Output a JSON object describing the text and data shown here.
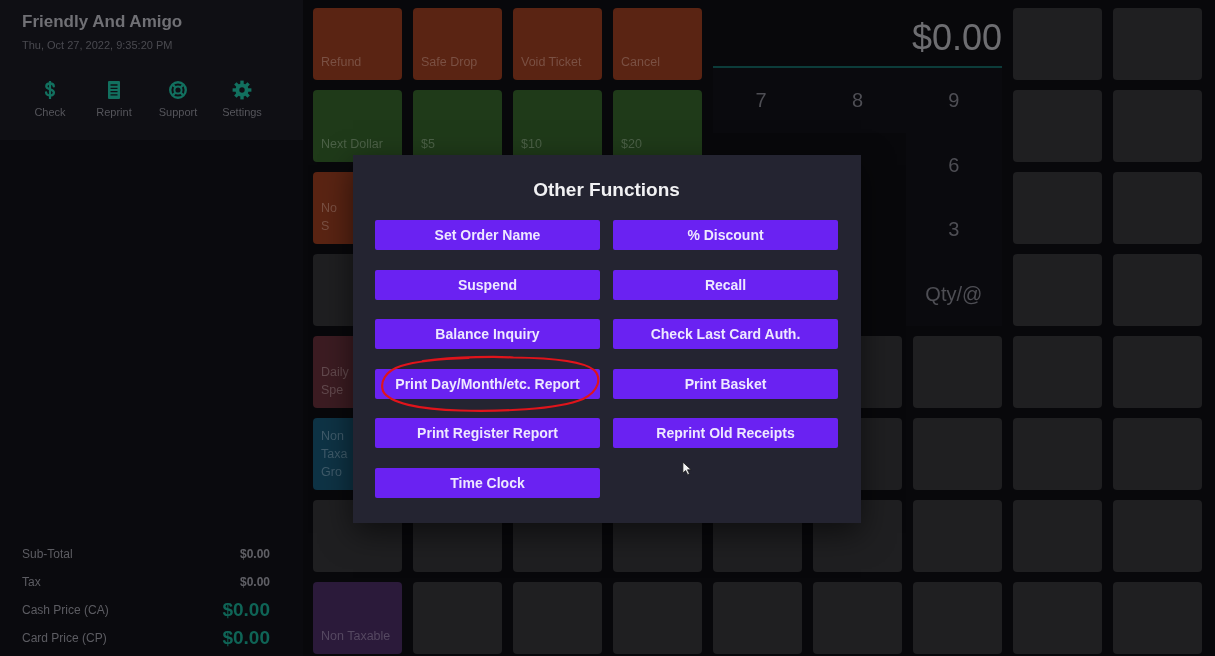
{
  "store": {
    "name": "Friendly And Amigo",
    "datetime": "Thu, Oct 27, 2022, 9:35:20 PM"
  },
  "header_actions": [
    {
      "label": "Check"
    },
    {
      "label": "Reprint"
    },
    {
      "label": "Support"
    },
    {
      "label": "Settings"
    }
  ],
  "totals": [
    {
      "label": "Sub-Total",
      "amount": "$0.00",
      "kind": "plain"
    },
    {
      "label": "Tax",
      "amount": "$0.00",
      "kind": "plain"
    },
    {
      "label": "Cash Price (CA)",
      "amount": "$0.00",
      "kind": "price"
    },
    {
      "label": "Card Price (CP)",
      "amount": "$0.00",
      "kind": "price"
    }
  ],
  "display": {
    "amount": "$0.00"
  },
  "keypad": [
    [
      "7",
      "8",
      "9"
    ],
    [
      "6"
    ],
    [
      "3"
    ],
    [
      "Qty/@"
    ]
  ],
  "tile_rows": [
    [
      {
        "label": "Refund",
        "color": "#5a2413"
      },
      {
        "label": "Safe Drop",
        "color": "#5a2413",
        "cut_off": false
      },
      {
        "label": "Void Ticket",
        "color": "#5a2413",
        "cut_off": false
      },
      {
        "label": "Cancel",
        "color": "#5a2413"
      },
      {
        "color": "#1f1f21"
      },
      {
        "color": "#1f1f21"
      }
    ],
    [
      {
        "label": "Next Dollar",
        "color": "#1f3a19",
        "cut_off": false
      },
      {
        "label": "$5",
        "color": "#1f3a19"
      },
      {
        "label": "$10",
        "color": "#1f3a19"
      },
      {
        "label": "$20",
        "color": "#1f3a19"
      },
      {
        "color": "#1f1f21"
      },
      {
        "color": "#1f1f21"
      }
    ],
    [
      {
        "label": "No S",
        "color": "#5a2413",
        "cut_off": true
      },
      null,
      null,
      null,
      {
        "color": "#1f1f21"
      },
      {
        "color": "#1f1f21"
      }
    ],
    [
      {
        "color": "#1f1f21"
      },
      null,
      null,
      null,
      {
        "color": "#1f1f21"
      },
      {
        "color": "#1f1f21"
      }
    ],
    [
      {
        "label": "Daily Spe",
        "color": "#3c1c22",
        "cut_off": true
      },
      null,
      null,
      null,
      null,
      {
        "color": "#1f1f21"
      },
      {
        "color": "#1f1f21"
      },
      {
        "color": "#1f1f21"
      },
      {
        "color": "#1f1f21"
      }
    ],
    [
      {
        "label": "Non Taxa Gro",
        "color": "#0e3345",
        "cut_off": true
      },
      null,
      null,
      null,
      null,
      {
        "color": "#1f1f21"
      },
      {
        "color": "#1f1f21"
      },
      {
        "color": "#1f1f21"
      },
      {
        "color": "#1f1f21"
      }
    ],
    [
      {
        "color": "#1f1f21"
      },
      {
        "color": "#1f1f21"
      },
      {
        "color": "#1f1f21"
      },
      {
        "color": "#1f1f21"
      },
      {
        "color": "#1f1f21"
      },
      {
        "color": "#1f1f21"
      },
      {
        "color": "#1f1f21"
      },
      {
        "color": "#1f1f21"
      },
      {
        "color": "#1f1f21"
      }
    ],
    [
      {
        "label": "Non Taxable",
        "color": "#2b1a3a",
        "cut_off": false
      },
      {
        "color": "#1f1f21"
      },
      {
        "color": "#1f1f21"
      },
      {
        "color": "#1f1f21"
      },
      {
        "color": "#1f1f21"
      },
      {
        "color": "#1f1f21"
      },
      {
        "color": "#1f1f21"
      },
      {
        "color": "#1f1f21"
      },
      {
        "color": "#1f1f21"
      }
    ]
  ],
  "dialog": {
    "title": "Other Functions",
    "buttons": [
      {
        "label": "Set Order Name",
        "circled": false
      },
      {
        "label": "% Discount",
        "circled": false
      },
      {
        "label": "Suspend",
        "circled": false
      },
      {
        "label": "Recall",
        "circled": false
      },
      {
        "label": "Balance Inquiry",
        "circled": false
      },
      {
        "label": "Check Last Card Auth.",
        "circled": false
      },
      {
        "label": "Print Day/Month/etc. Report",
        "circled": true
      },
      {
        "label": "Print Basket",
        "circled": false
      },
      {
        "label": "Print Register Report",
        "circled": false
      },
      {
        "label": "Reprint Old Receipts",
        "circled": false
      },
      {
        "label": "Time Clock",
        "circled": false
      }
    ]
  }
}
